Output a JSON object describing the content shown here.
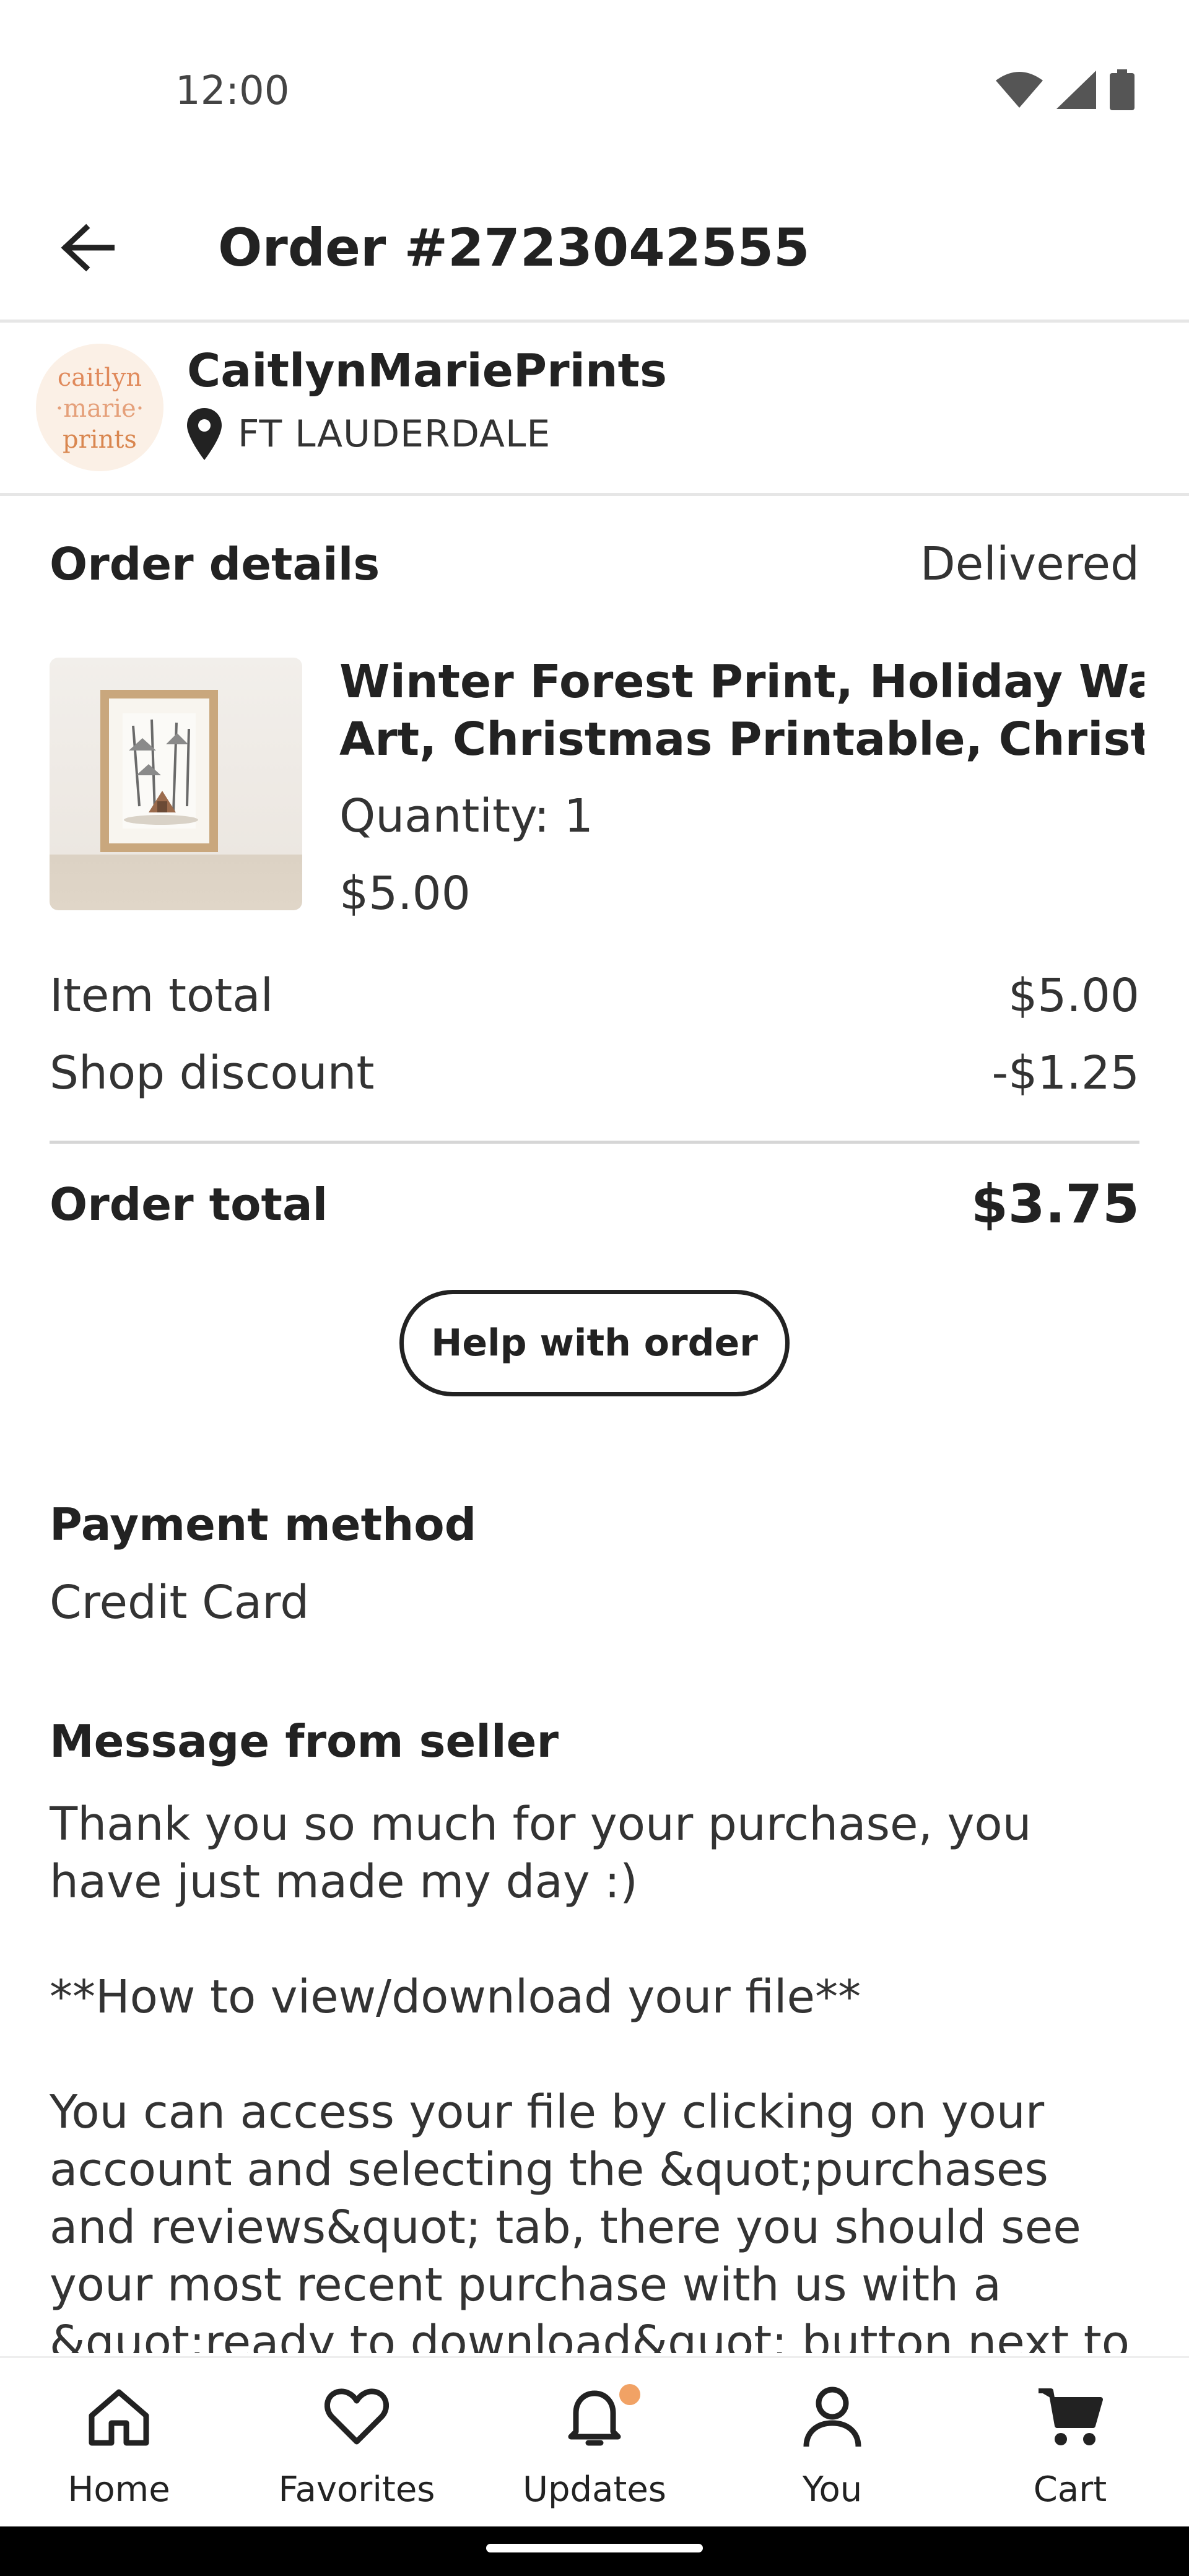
{
  "status_bar": {
    "time": "12:00"
  },
  "header": {
    "title": "Order #2723042555"
  },
  "shop": {
    "name": "CaitlynMariePrints",
    "location": "FT LAUDERDALE",
    "logo_lines": [
      "caitlyn",
      "·marie·",
      "prints"
    ]
  },
  "order": {
    "section_label": "Order details",
    "status": "Delivered",
    "item": {
      "title_line1": "Winter Forest Print, Holiday Wall",
      "title_line2": "Art, Christmas Printable, Christ...",
      "quantity": "Quantity: 1",
      "price": "$5.00"
    },
    "summary": {
      "item_total_label": "Item total",
      "item_total_value": "$5.00",
      "discount_label": "Shop discount",
      "discount_value": "-$1.25",
      "order_total_label": "Order total",
      "order_total_value": "$3.75"
    },
    "help_button": "Help with order"
  },
  "payment": {
    "label": "Payment method",
    "value": "Credit Card"
  },
  "seller_message": {
    "label": "Message from seller",
    "lines": [
      "Thank you so much for your purchase, you",
      "have just made my day :)",
      "",
      "**How to view/download your file**",
      "",
      "You can access your file by clicking on your",
      "account and selecting the &quot;purchases",
      "and reviews&quot; tab, there you should see",
      "your most recent purchase with us with a",
      "&quot;ready to download&quot; button next to"
    ]
  },
  "bottom_nav": [
    {
      "label": "Home",
      "icon": "home-icon"
    },
    {
      "label": "Favorites",
      "icon": "heart-icon"
    },
    {
      "label": "Updates",
      "icon": "bell-icon"
    },
    {
      "label": "You",
      "icon": "person-icon"
    },
    {
      "label": "Cart",
      "icon": "cart-icon"
    }
  ],
  "colors": {
    "text": "#222222",
    "divider": "#d6d6d6",
    "badge": "#f1a265",
    "logo_text": "#e08a5c"
  }
}
